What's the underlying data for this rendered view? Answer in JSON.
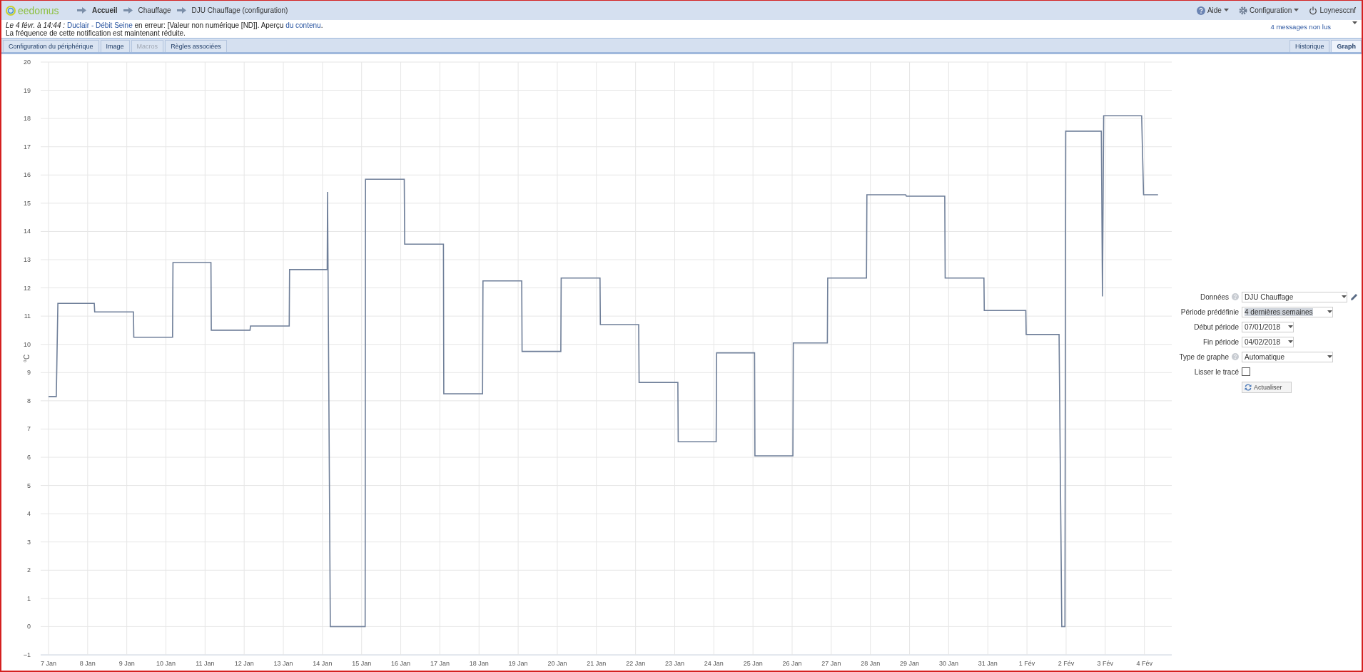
{
  "header": {
    "logo": "eedomus",
    "breadcrumb": [
      {
        "label": "Accueil",
        "selected": true
      },
      {
        "label": "Chauffage",
        "selected": false
      },
      {
        "label": "DJU Chauffage (configuration)",
        "selected": false
      }
    ],
    "menu": [
      {
        "label": "Aide",
        "kind": "help",
        "dropdown": true
      },
      {
        "label": "Configuration",
        "kind": "settings",
        "dropdown": true
      },
      {
        "label": "Loynesccnf",
        "kind": "power",
        "dropdown": false
      }
    ]
  },
  "notification": {
    "parts": [
      {
        "kind": "italic",
        "text": "Le 4 févr. à 14:44 :"
      },
      {
        "kind": "link",
        "text": "Duclair - Débit Seine"
      },
      {
        "kind": "text",
        "text": " en erreur: [Valeur non numérique [ND]]. Aperçu "
      },
      {
        "kind": "link",
        "text": "du contenu"
      },
      {
        "kind": "text",
        "text": "."
      }
    ],
    "second_line": "La fréquence de cette notification est maintenant réduite.",
    "unread": "4 messages non lus"
  },
  "tabs_left": [
    {
      "label": "Configuration du périphérique",
      "selected": false,
      "disabled": false
    },
    {
      "label": "Image",
      "selected": false,
      "disabled": false
    },
    {
      "label": "Macros",
      "selected": false,
      "disabled": true
    },
    {
      "label": "Règles associées",
      "selected": false,
      "disabled": false
    }
  ],
  "tabs_right": [
    {
      "label": "Historique",
      "selected": false
    },
    {
      "label": "Graph",
      "selected": true
    }
  ],
  "chart": {
    "chart_data": {
      "type": "line",
      "ylabel": "°C",
      "grid": true,
      "xlim": [
        "2018-01-06T19:12",
        "2018-02-04T21:36"
      ],
      "ylim": [
        -1,
        20
      ],
      "yticks": [
        -1,
        0,
        1,
        2,
        3,
        4,
        5,
        6,
        7,
        8,
        9,
        10,
        11,
        12,
        13,
        14,
        15,
        16,
        17,
        18,
        19,
        20
      ],
      "xticks": [
        {
          "value": "2018-01-07",
          "label": "7 Jan"
        },
        {
          "value": "2018-01-08",
          "label": "8 Jan"
        },
        {
          "value": "2018-01-09",
          "label": "9 Jan"
        },
        {
          "value": "2018-01-10",
          "label": "10 Jan"
        },
        {
          "value": "2018-01-11",
          "label": "11 Jan"
        },
        {
          "value": "2018-01-12",
          "label": "12 Jan"
        },
        {
          "value": "2018-01-13",
          "label": "13 Jan"
        },
        {
          "value": "2018-01-14",
          "label": "14 Jan"
        },
        {
          "value": "2018-01-15",
          "label": "15 Jan"
        },
        {
          "value": "2018-01-16",
          "label": "16 Jan"
        },
        {
          "value": "2018-01-17",
          "label": "17 Jan"
        },
        {
          "value": "2018-01-18",
          "label": "18 Jan"
        },
        {
          "value": "2018-01-19",
          "label": "19 Jan"
        },
        {
          "value": "2018-01-20",
          "label": "20 Jan"
        },
        {
          "value": "2018-01-21",
          "label": "21 Jan"
        },
        {
          "value": "2018-01-22",
          "label": "22 Jan"
        },
        {
          "value": "2018-01-23",
          "label": "23 Jan"
        },
        {
          "value": "2018-01-24",
          "label": "24 Jan"
        },
        {
          "value": "2018-01-25",
          "label": "25 Jan"
        },
        {
          "value": "2018-01-26",
          "label": "26 Jan"
        },
        {
          "value": "2018-01-27",
          "label": "27 Jan"
        },
        {
          "value": "2018-01-28",
          "label": "28 Jan"
        },
        {
          "value": "2018-01-29",
          "label": "29 Jan"
        },
        {
          "value": "2018-01-30",
          "label": "30 Jan"
        },
        {
          "value": "2018-01-31",
          "label": "31 Jan"
        },
        {
          "value": "2018-02-01",
          "label": "1 Fév"
        },
        {
          "value": "2018-02-02",
          "label": "2 Fév"
        },
        {
          "value": "2018-02-03",
          "label": "3 Fév"
        },
        {
          "value": "2018-02-04",
          "label": "4 Fév"
        }
      ],
      "x": [
        "2018-01-07T00:00",
        "2018-01-07T04:48",
        "2018-01-07T05:46",
        "2018-01-08T04:05",
        "2018-01-08T04:19",
        "2018-01-09T04:05",
        "2018-01-09T04:19",
        "2018-01-10T04:05",
        "2018-01-10T04:19",
        "2018-01-11T03:36",
        "2018-01-11T03:50",
        "2018-01-12T03:36",
        "2018-01-12T03:50",
        "2018-01-13T03:36",
        "2018-01-13T03:50",
        "2018-01-14T02:53",
        "2018-01-14T03:07",
        "2018-01-14T04:48",
        "2018-01-15T02:10",
        "2018-01-15T02:24",
        "2018-01-16T02:10",
        "2018-01-16T02:24",
        "2018-01-17T02:10",
        "2018-01-17T02:24",
        "2018-01-18T02:10",
        "2018-01-18T02:24",
        "2018-01-19T02:10",
        "2018-01-19T02:24",
        "2018-01-20T02:10",
        "2018-01-20T02:24",
        "2018-01-21T02:10",
        "2018-01-21T02:24",
        "2018-01-22T01:55",
        "2018-01-22T02:10",
        "2018-01-23T01:55",
        "2018-01-23T02:10",
        "2018-01-24T01:26",
        "2018-01-24T01:41",
        "2018-01-25T00:58",
        "2018-01-25T01:12",
        "2018-01-26T00:29",
        "2018-01-26T00:43",
        "2018-01-26T21:36",
        "2018-01-26T21:50",
        "2018-01-27T21:36",
        "2018-01-27T21:50",
        "2018-01-28T21:36",
        "2018-01-28T22:05",
        "2018-01-29T21:36",
        "2018-01-29T21:50",
        "2018-01-30T21:36",
        "2018-01-30T21:50",
        "2018-01-31T23:17",
        "2018-01-31T23:31",
        "2018-02-01T19:41",
        "2018-02-01T21:22",
        "2018-02-01T23:17",
        "2018-02-01T23:46",
        "2018-02-02T21:36",
        "2018-02-02T22:19",
        "2018-02-02T23:02",
        "2018-02-03T22:19",
        "2018-02-03T23:31",
        "2018-02-04T08:24"
      ],
      "series": [
        {
          "color": "#6f7f99",
          "values": [
            8.15,
            8.15,
            11.45,
            11.45,
            11.15,
            11.15,
            10.25,
            10.25,
            12.9,
            12.9,
            10.5,
            10.5,
            10.65,
            10.65,
            12.65,
            12.65,
            15.4,
            0,
            0,
            15.85,
            15.85,
            13.55,
            13.55,
            8.25,
            8.25,
            12.25,
            12.25,
            9.75,
            9.75,
            12.35,
            12.35,
            10.7,
            10.7,
            8.65,
            8.65,
            6.55,
            6.55,
            9.7,
            9.7,
            6.05,
            6.05,
            10.05,
            10.05,
            12.35,
            12.35,
            15.3,
            15.3,
            15.25,
            15.25,
            12.35,
            12.35,
            11.2,
            11.2,
            10.35,
            10.35,
            0,
            0,
            17.55,
            17.55,
            11.7,
            18.1,
            18.1,
            15.3,
            15.3
          ]
        }
      ]
    }
  },
  "form": {
    "rows": [
      {
        "label": "Données",
        "help": true,
        "kind": "select",
        "value": "DJU Chauffage",
        "edit": true
      },
      {
        "label": "Période prédéfinie",
        "help": false,
        "kind": "select",
        "value": "4 dernières semaines",
        "highlighted": true
      },
      {
        "label": "Début période",
        "help": false,
        "kind": "date",
        "value": "07/01/2018"
      },
      {
        "label": "Fin période",
        "help": false,
        "kind": "date",
        "value": "04/02/2018"
      },
      {
        "label": "Type de graphe",
        "help": true,
        "kind": "select",
        "value": "Automatique"
      },
      {
        "label": "Lisser le tracé",
        "help": false,
        "kind": "checkbox",
        "checked": false
      }
    ],
    "button": "Actualiser"
  }
}
